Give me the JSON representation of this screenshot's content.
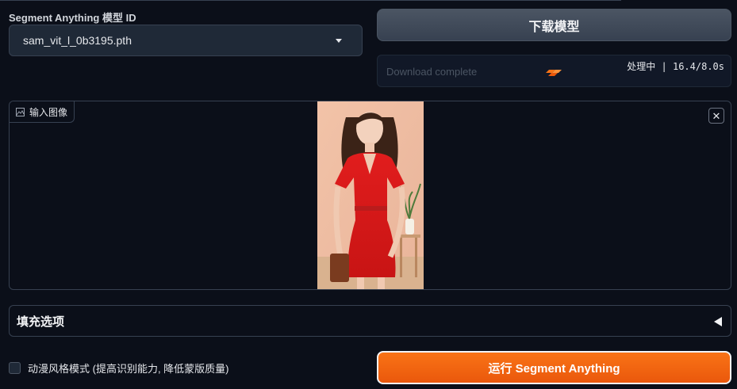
{
  "model": {
    "label": "Segment Anything 模型 ID",
    "selected": "sam_vit_l_0b3195.pth"
  },
  "download": {
    "button_label": "下载模型",
    "status_placeholder": "Download complete",
    "progress_text": "处理中 | 16.4/8.0s"
  },
  "image_input": {
    "label": "输入图像",
    "clear_label": "✕"
  },
  "fill_options": {
    "label": "填充选项"
  },
  "anime_mode": {
    "label": "动漫风格模式 (提高识别能力, 降低蒙版质量)",
    "checked": false
  },
  "run": {
    "label": "运行 Segment Anything"
  },
  "colors": {
    "background": "#0b0f19",
    "accent": "#f97316",
    "panel": "#1f2937"
  }
}
